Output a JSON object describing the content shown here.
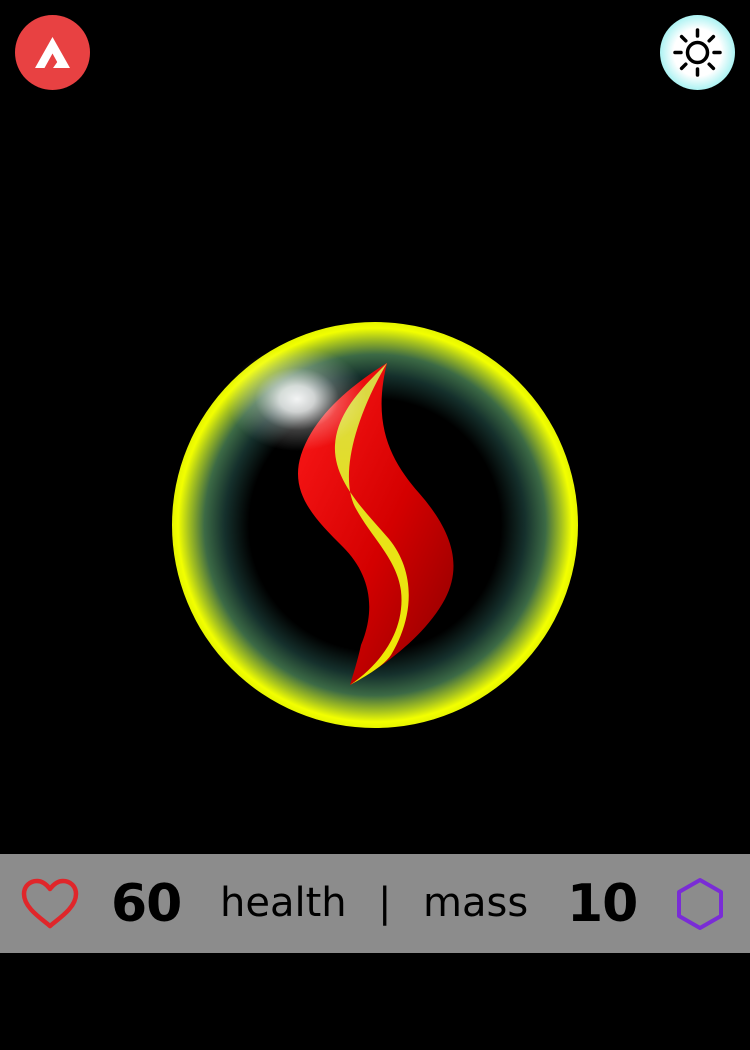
{
  "top_bar": {
    "logo_color": "#e84142",
    "theme_button_color": "#aef3f3"
  },
  "creature": {
    "ring_color": "#f2ff00",
    "glow_color": "#1a3a35",
    "flame_outer_color": "#e00000",
    "flame_inner_color": "#e3e11f"
  },
  "stats": {
    "health_value": "60",
    "health_label": "health",
    "separator": "|",
    "mass_label": "mass",
    "mass_value": "10",
    "heart_color": "#e0262a",
    "hex_color": "#7a2cd6",
    "bar_color": "#8c8c8c"
  }
}
